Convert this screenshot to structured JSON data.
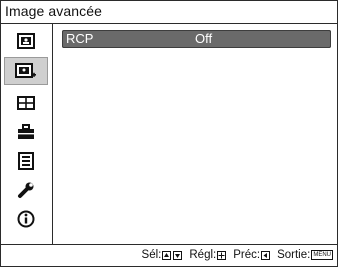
{
  "title": "Image avancée",
  "sidebar": {
    "items": [
      {
        "icon": "picture-icon"
      },
      {
        "icon": "advanced-picture-icon",
        "selected": true
      },
      {
        "icon": "screen-icon"
      },
      {
        "icon": "setup-icon"
      },
      {
        "icon": "menu-settings-icon"
      },
      {
        "icon": "wrench-icon"
      },
      {
        "icon": "info-icon"
      }
    ]
  },
  "main": {
    "rcp": {
      "label": "RCP",
      "value": "Off"
    }
  },
  "footer": {
    "sel": "Sél:",
    "regl": "Régl:",
    "prec": "Préc:",
    "sortie": "Sortie:",
    "menu_key": "MENU"
  }
}
